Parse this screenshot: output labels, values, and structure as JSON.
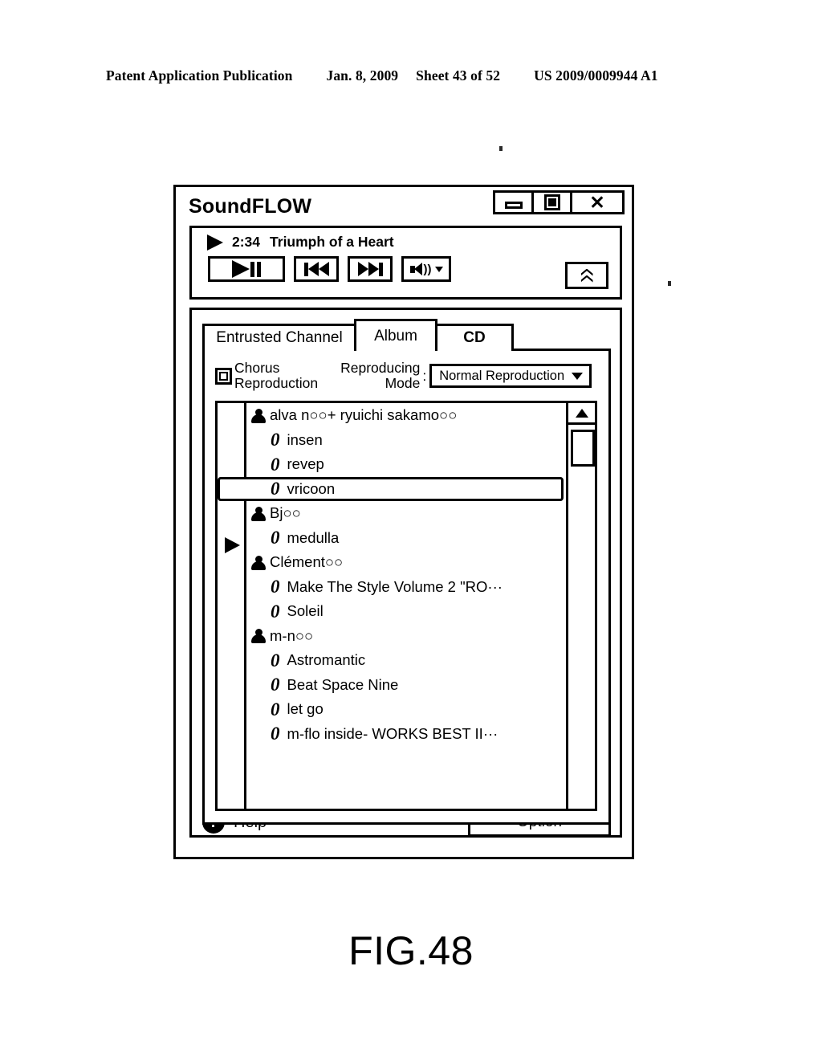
{
  "page_header": {
    "publication": "Patent Application Publication",
    "date": "Jan. 8, 2009",
    "sheet": "Sheet 43 of 52",
    "patent_number": "US 2009/0009944 A1"
  },
  "figure": {
    "caption": "FIG.48"
  },
  "window": {
    "title": "SoundFLOW",
    "controls": {
      "minimize": "minimize-icon",
      "maximize": "maximize-icon",
      "close": "✕"
    }
  },
  "player": {
    "status_icon": "play-triangle-icon",
    "time": "2:34",
    "track_title": "Triumph of a Heart",
    "buttons": {
      "play_pause": "play-pause-icon",
      "previous": "previous-track-icon",
      "next": "next-track-icon",
      "volume": "volume-speaker-icon",
      "volume_caret": "▼",
      "collapse": "double-chevron-up-icon"
    }
  },
  "tabs": [
    {
      "label": "Entrusted Channel",
      "active": false
    },
    {
      "label": "Album",
      "active": true
    },
    {
      "label": "CD",
      "active": false
    }
  ],
  "options": {
    "chorus_checkbox": {
      "label_line1": "Chorus",
      "label_line2": "Reproduction",
      "checked": false
    },
    "reproducing_mode": {
      "label_line1": "Reproducing",
      "label_line2": "Mode",
      "separator": ":",
      "selected": "Normal Reproduction",
      "caret": "▼"
    }
  },
  "list": {
    "disc_glyph": "0",
    "rows": [
      {
        "type": "artist",
        "label": "alva n○○+  ryuichi sakamo○○",
        "selected": false,
        "marker": false
      },
      {
        "type": "album",
        "label": "insen",
        "selected": false,
        "marker": false
      },
      {
        "type": "album",
        "label": "revep",
        "selected": false,
        "marker": false
      },
      {
        "type": "album",
        "label": "vricoon",
        "selected": true,
        "marker": false
      },
      {
        "type": "artist",
        "label": "Bj○○",
        "selected": false,
        "marker": false
      },
      {
        "type": "album",
        "label": "medulla",
        "selected": false,
        "marker": true
      },
      {
        "type": "artist",
        "label": "Clément○○",
        "selected": false,
        "marker": false
      },
      {
        "type": "album",
        "label": "Make The Style Volume 2 \"RO···",
        "selected": false,
        "marker": false
      },
      {
        "type": "album",
        "label": "Soleil",
        "selected": false,
        "marker": false
      },
      {
        "type": "artist",
        "label": "m-n○○",
        "selected": false,
        "marker": false
      },
      {
        "type": "album",
        "label": "Astromantic",
        "selected": false,
        "marker": false
      },
      {
        "type": "album",
        "label": "Beat Space Nine",
        "selected": false,
        "marker": false
      },
      {
        "type": "album",
        "label": "let go",
        "selected": false,
        "marker": false
      },
      {
        "type": "album",
        "label": "m-flo inside- WORKS BEST II···",
        "selected": false,
        "marker": false
      }
    ],
    "scrollbar": {
      "up_arrow": "scroll-up-arrow-icon"
    }
  },
  "footer": {
    "help_icon": "?",
    "help_label": "Help",
    "option_label": "Option"
  }
}
